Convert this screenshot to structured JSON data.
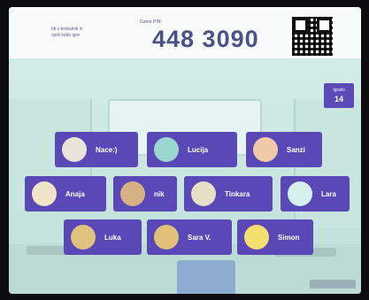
{
  "header": {
    "join_line_1": "Idi v brskalnik in",
    "join_line_2": "vpiši kodo igre",
    "code_label": "Game PIN:",
    "game_pin": "448 3090"
  },
  "player_count": {
    "label": "Igralci",
    "value": "14"
  },
  "players": [
    {
      "name": "Nace:)",
      "avatar": "egg-avatar-icon",
      "color": "#e9e4d8"
    },
    {
      "name": "Lucija",
      "avatar": "teal-creature-avatar-icon",
      "color": "#9ad7cf"
    },
    {
      "name": "Sanzi",
      "avatar": "dragon-avatar-icon",
      "color": "#f0c9a6"
    },
    {
      "name": "Anaja",
      "avatar": "egg-avatar-icon",
      "color": "#efe3c8"
    },
    {
      "name": "nik",
      "avatar": "pirate-avatar-icon",
      "color": "#d7b184"
    },
    {
      "name": "Tinkara",
      "avatar": "viking-avatar-icon",
      "color": "#e8dfc7"
    },
    {
      "name": "Lara",
      "avatar": "ghost-avatar-icon",
      "color": "#d6f0ee"
    },
    {
      "name": "Luka",
      "avatar": "cowboy-avatar-icon",
      "color": "#e2c27f"
    },
    {
      "name": "Sara V.",
      "avatar": "bread-avatar-icon",
      "color": "#e3c07a"
    },
    {
      "name": "Simon",
      "avatar": "chick-avatar-icon",
      "color": "#f3e06e"
    }
  ]
}
